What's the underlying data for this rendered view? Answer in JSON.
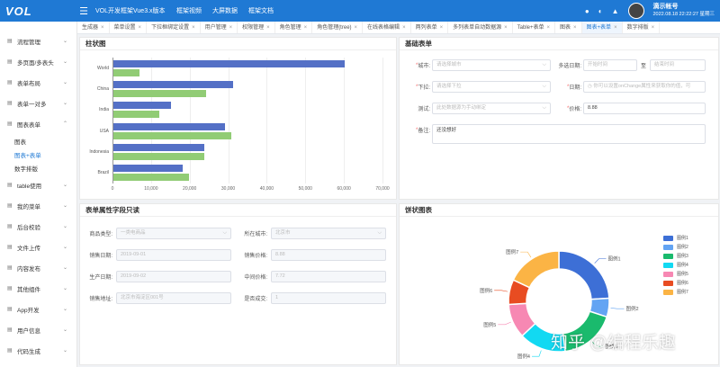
{
  "topbar": {
    "logo": "VOL",
    "product": "VOL开发框架Vue3.x版本",
    "nav": [
      "框架视频",
      "大屏数据",
      "框架文档"
    ],
    "user_name": "滴示帐号",
    "user_date": "2022.08.18 22:22:27 星期三"
  },
  "tabs": [
    {
      "label": "生成器"
    },
    {
      "label": "菜单设置"
    },
    {
      "label": "下拉框绑定设置"
    },
    {
      "label": "用户管理"
    },
    {
      "label": "权限管理"
    },
    {
      "label": "角色管理"
    },
    {
      "label": "角色管理(tree)"
    },
    {
      "label": "在线表格编辑"
    },
    {
      "label": "两列表单"
    },
    {
      "label": "多列表单自动数据源"
    },
    {
      "label": "Table+表单"
    },
    {
      "label": "图表"
    },
    {
      "label": "图表+表单"
    },
    {
      "label": "数字排版"
    }
  ],
  "sidebar": {
    "items": [
      {
        "label": "流程管理"
      },
      {
        "label": "多页面/多表头"
      },
      {
        "label": "表单布局"
      },
      {
        "label": "表单一对多"
      },
      {
        "label": "图表表单"
      }
    ],
    "subitems": [
      {
        "label": "图表"
      },
      {
        "label": "图表+表单"
      },
      {
        "label": "数字排版"
      }
    ],
    "items2": [
      {
        "label": "table使用"
      },
      {
        "label": "我的菜单"
      },
      {
        "label": "后台校验"
      },
      {
        "label": "文件上传"
      },
      {
        "label": "内容发布"
      },
      {
        "label": "其他组件"
      },
      {
        "label": "App开发"
      },
      {
        "label": "用户信息"
      },
      {
        "label": "代码生成"
      }
    ]
  },
  "bar_panel": {
    "title": "柱状图"
  },
  "chart_data": [
    {
      "type": "bar",
      "orientation": "horizontal",
      "categories": [
        "World",
        "China",
        "India",
        "USA",
        "Indonesia",
        "Brazil"
      ],
      "series": [
        {
          "values": [
            60000,
            31000,
            15000,
            29000,
            23500,
            18000
          ],
          "color": "#5470c6"
        },
        {
          "values": [
            6800,
            24000,
            12000,
            30500,
            23500,
            19500
          ],
          "color": "#91cc75"
        }
      ],
      "xlim": [
        0,
        70000
      ],
      "xticks": [
        "0",
        "10,000",
        "20,000",
        "30,000",
        "40,000",
        "50,000",
        "60,000",
        "70,000"
      ]
    },
    {
      "type": "pie",
      "donut": true,
      "categories": [
        "图例1",
        "图例2",
        "图例3",
        "图例4",
        "图例5",
        "图例6",
        "图例7"
      ],
      "values": [
        24,
        6,
        18,
        15,
        11,
        8,
        18
      ],
      "colors": [
        "#3d6fd6",
        "#63a4f3",
        "#1aba6d",
        "#12d9f2",
        "#f788b3",
        "#e84c22",
        "#fbb445"
      ]
    }
  ],
  "basic_form": {
    "title": "基础表单",
    "city_label": "城市:",
    "city_placeholder": "请选择城市",
    "multi_date_label": "多选日期:",
    "start_placeholder": "开始时间",
    "range_sep": "至",
    "end_placeholder": "结束时间",
    "dropdown_label": "下拉:",
    "dropdown_placeholder": "请选择下拉",
    "date_label": "日期:",
    "date_placeholder": "你可以设置onChange属性来获取你的值，可",
    "test_label": "测试:",
    "test_placeholder": "此处数据源为手动绑定",
    "price_label": "价格:",
    "price_value": "8.88",
    "remark_label": "备注:",
    "remark_value": "还没想好"
  },
  "readonly_form": {
    "title": "表单属性字段只读",
    "product_type_label": "商品类型:",
    "product_type_value": "一类电商品",
    "city_label": "所在城市:",
    "city_value": "北京市",
    "sale_date_label": "销售日期:",
    "sale_date_value": "2019-09-01",
    "sale_price_label": "销售价格:",
    "sale_price_value": "8.88",
    "prod_date_label": "生产日期:",
    "prod_date_value": "2019-09-02",
    "mid_price_label": "中间价格:",
    "mid_price_value": "7.72",
    "address_label": "销售地址:",
    "address_value": "北京市海淀区001号",
    "deal_label": "是否成交:",
    "deal_value": "1"
  },
  "pie_panel": {
    "title": "饼状图表"
  },
  "watermark": "知乎 @编程乐趣"
}
